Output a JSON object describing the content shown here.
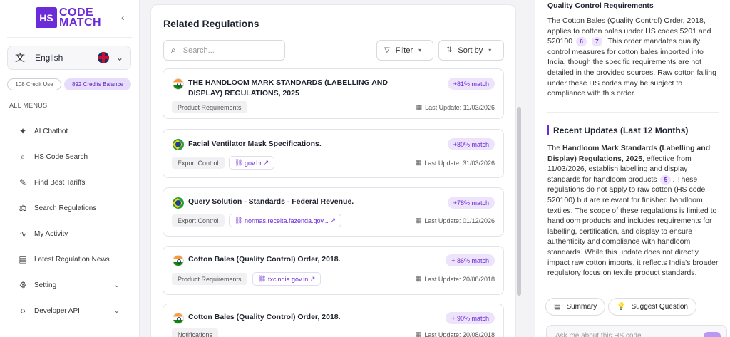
{
  "brand": {
    "logo_mark": "HS",
    "logo_line1": "CODE",
    "logo_line2": "MATCH"
  },
  "sidebar": {
    "language": "English",
    "credits_used": "108 Credit Use",
    "credits_balance": "892 Credits Balance",
    "menus_title": "ALL MENUS",
    "items": [
      {
        "label": "AI Chatbot",
        "icon": "sparkle-icon"
      },
      {
        "label": "HS Code Search",
        "icon": "search-icon"
      },
      {
        "label": "Find Best Tariffs",
        "icon": "ruler-icon"
      },
      {
        "label": "Search Regulations",
        "icon": "scale-icon"
      },
      {
        "label": "My Activity",
        "icon": "activity-icon"
      },
      {
        "label": "Latest Regulation News",
        "icon": "newspaper-icon"
      },
      {
        "label": "Setting",
        "icon": "gear-icon"
      },
      {
        "label": "Developer API",
        "icon": "code-icon"
      }
    ]
  },
  "main": {
    "title": "Related Regulations",
    "search_placeholder": "Search...",
    "filter_label": "Filter",
    "sort_label": "Sort by",
    "regulations": [
      {
        "flag": "india",
        "title": "THE HANDLOOM MARK STANDARDS (LABELLING AND DISPLAY) REGULATIONS, 2025",
        "match": "+81% match",
        "tag": "Product Requirements",
        "link": "",
        "date": "Last Update: 11/03/2026"
      },
      {
        "flag": "brazil",
        "title": "Facial Ventilator Mask Specifications.",
        "match": "+80% match",
        "tag": "Export Control",
        "link": "gov.br",
        "date": "Last Update: 31/03/2026"
      },
      {
        "flag": "brazil",
        "title": "Query Solution - Standards - Federal Revenue.",
        "match": "+78% match",
        "tag": "Export Control",
        "link": "normas.receita.fazenda.gov...",
        "date": "Last Update: 01/12/2026"
      },
      {
        "flag": "india",
        "title": "Cotton Bales (Quality Control) Order, 2018.",
        "match": "+ 86% match",
        "tag": "Product Requirements",
        "link": "txcindia.gov.in",
        "date": "Last Update: 20/08/2018"
      },
      {
        "flag": "india",
        "title": "Cotton Bales (Quality Control) Order, 2018.",
        "match": "+ 90% match",
        "tag": "Notifications",
        "link": "",
        "date": "Last Update: 20/08/2018"
      }
    ]
  },
  "panel": {
    "qc_heading": "Quality Control Requirements",
    "qc_text_a": "The Cotton Bales (Quality Control) Order, 2018, applies to cotton bales under HS codes 5201 and 520100",
    "qc_cite1": "6",
    "qc_cite2": "7",
    "qc_text_b": ". This order mandates quality control measures for cotton bales imported into India, though the specific requirements are not detailed in the provided sources. Raw cotton falling under these HS codes may be subject to compliance with this order.",
    "recent_heading": "Recent Updates (Last 12 Months)",
    "ru_text_a": "The ",
    "ru_bold": "Handloom Mark Standards (Labelling and Display) Regulations, 2025",
    "ru_text_b": ", effective from 11/03/2026, establish labelling and display standards for handloom products",
    "ru_cite": "5",
    "ru_text_c": ". These regulations do not apply to raw cotton (HS code 520100) but are relevant for finished handloom textiles. The scope of these regulations is limited to handloom products and includes requirements for labelling, certification, and display to ensure authenticity and compliance with handloom standards. While this update does not directly impact raw cotton imports, it reflects India's broader regulatory focus on textile product standards.",
    "summary_label": "Summary",
    "suggest_label": "Suggest Question",
    "ask_placeholder": "Ask me about this HS code"
  },
  "colors": {
    "accent": "#6d28d9",
    "accent_light": "#ede4fc"
  }
}
